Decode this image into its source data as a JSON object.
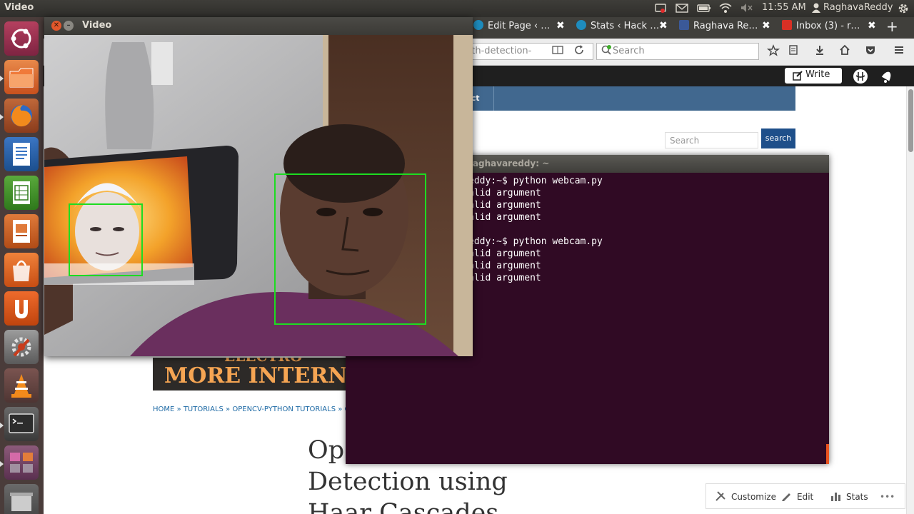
{
  "panel": {
    "title": "Video",
    "time": "11:55 AM",
    "user": "RaghavaReddy",
    "icons": [
      "record-icon",
      "mail-icon",
      "battery-icon",
      "wifi-icon",
      "volume-mute-icon",
      "user-icon",
      "settings-gear-icon"
    ]
  },
  "launcher": {
    "items": [
      "ubuntu-dash-icon",
      "files-icon",
      "firefox-icon",
      "writer-icon",
      "calc-icon",
      "impress-icon",
      "software-center-icon",
      "ubuntu-one-icon",
      "system-settings-icon",
      "vlc-icon",
      "terminal-icon",
      "workspaces-icon",
      "trash-icon"
    ]
  },
  "browser": {
    "tabs": [
      {
        "label": "Edit Page ‹ …",
        "favicon_color": "#1e8cbe"
      },
      {
        "label": "Stats ‹ Hack …",
        "favicon_color": "#1e8cbe"
      },
      {
        "label": "Raghava Re…",
        "favicon_color": "#3b5998"
      },
      {
        "label": "Inbox (3) - r…",
        "favicon_color": "#d93025"
      }
    ],
    "new_tab": "+",
    "close_glyph": "✖",
    "url_text": "uth-detection-",
    "search_placeholder": "Search"
  },
  "wpbar": {
    "write_label": "Write"
  },
  "page": {
    "nav_item": "ict",
    "search_placeholder": "Search",
    "search_button": "search",
    "banner_top": "ELECTRO",
    "banner_text": "MORE INTERN",
    "breadcrumb": "HOME » TUTORIALS » OPENCV-PYTHON TUTORIALS » OP",
    "title_lines": [
      "Op",
      "Detection using",
      "Haar Cascades"
    ],
    "admin_float": {
      "customize": "Customize",
      "edit": "Edit",
      "stats": "Stats",
      "more": "•••"
    }
  },
  "terminal": {
    "title": "raghavareddy: ~",
    "lines": [
      "eddy:~$ python webcam.py",
      "alid argument",
      "alid argument",
      "alid argument",
      "",
      "eddy:~$ python webcam.py",
      "alid argument",
      "alid argument",
      "alid argument"
    ]
  },
  "video_window": {
    "title": "Video",
    "detections": 2
  }
}
